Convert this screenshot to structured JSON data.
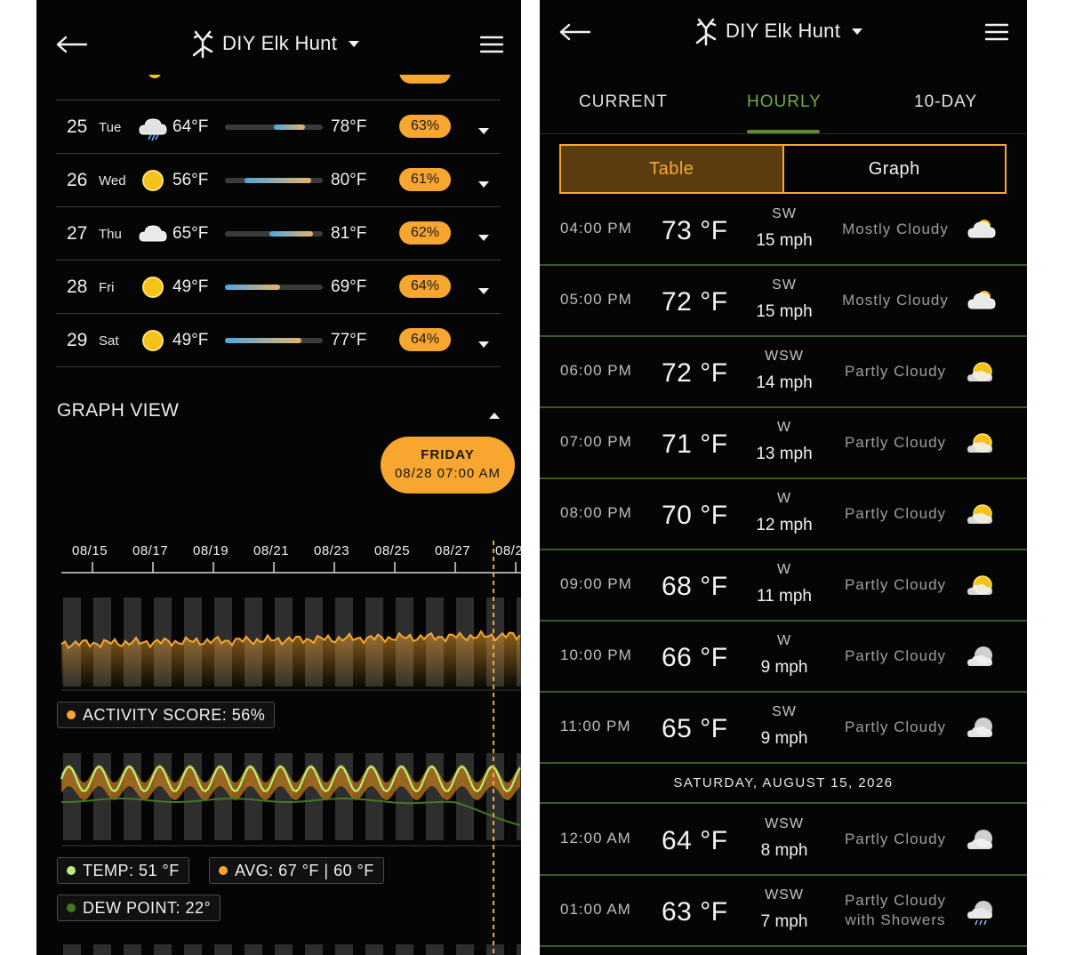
{
  "app": {
    "title": "DIY Elk Hunt"
  },
  "daily": [
    {
      "day": "25",
      "dow": "Tue",
      "icon": "thunder-cloud-icon",
      "low": "64°F",
      "high": "78°F",
      "score": "63%",
      "bar_start": 0.5,
      "bar_end": 0.82
    },
    {
      "day": "26",
      "dow": "Wed",
      "icon": "sun-icon",
      "low": "56°F",
      "high": "80°F",
      "score": "61%",
      "bar_start": 0.2,
      "bar_end": 0.88
    },
    {
      "day": "27",
      "dow": "Thu",
      "icon": "cloud-icon",
      "low": "65°F",
      "high": "81°F",
      "score": "62%",
      "bar_start": 0.45,
      "bar_end": 0.9
    },
    {
      "day": "28",
      "dow": "Fri",
      "icon": "sun-icon",
      "low": "49°F",
      "high": "69°F",
      "score": "64%",
      "bar_start": 0.0,
      "bar_end": 0.56
    },
    {
      "day": "29",
      "dow": "Sat",
      "icon": "sun-icon",
      "low": "49°F",
      "high": "77°F",
      "score": "64%",
      "bar_start": 0.0,
      "bar_end": 0.78
    }
  ],
  "graph": {
    "title": "GRAPH VIEW",
    "bubble_day": "FRIDAY",
    "bubble_time": "08/28 07:00 AM",
    "dates": [
      "08/15",
      "08/17",
      "08/19",
      "08/21",
      "08/23",
      "08/25",
      "08/27",
      "08/2"
    ],
    "activity_label": "ACTIVITY SCORE: 56%",
    "temp_label": "TEMP: 51 °F",
    "avg_label": "AVG: 67 °F | 60 °F",
    "dew_label": "DEW POINT: 22°",
    "colors": {
      "activity": "#f7a730",
      "temp": "#b6f07a",
      "dew": "#3f7a1e"
    }
  },
  "tabs": [
    {
      "label": "CURRENT",
      "active": false
    },
    {
      "label": "HOURLY",
      "active": true
    },
    {
      "label": "10-DAY",
      "active": false
    }
  ],
  "segment": {
    "table": "Table",
    "graph": "Graph"
  },
  "hourly": [
    {
      "time": "04:00 PM",
      "temp": "73 °F",
      "dir": "SW",
      "speed": "15 mph",
      "cond": "Mostly Cloudy",
      "icon": "mostly-cloudy-icon"
    },
    {
      "time": "05:00 PM",
      "temp": "72 °F",
      "dir": "SW",
      "speed": "15 mph",
      "cond": "Mostly Cloudy",
      "icon": "mostly-cloudy-icon"
    },
    {
      "time": "06:00 PM",
      "temp": "72 °F",
      "dir": "WSW",
      "speed": "14 mph",
      "cond": "Partly Cloudy",
      "icon": "partly-cloudy-icon"
    },
    {
      "time": "07:00 PM",
      "temp": "71 °F",
      "dir": "W",
      "speed": "13 mph",
      "cond": "Partly Cloudy",
      "icon": "partly-cloudy-icon"
    },
    {
      "time": "08:00 PM",
      "temp": "70 °F",
      "dir": "W",
      "speed": "12 mph",
      "cond": "Partly Cloudy",
      "icon": "partly-cloudy-icon"
    },
    {
      "time": "09:00 PM",
      "temp": "68 °F",
      "dir": "W",
      "speed": "11 mph",
      "cond": "Partly Cloudy",
      "icon": "partly-cloudy-icon"
    },
    {
      "time": "10:00 PM",
      "temp": "66 °F",
      "dir": "W",
      "speed": "9 mph",
      "cond": "Partly Cloudy",
      "icon": "partly-cloudy-night-icon"
    },
    {
      "time": "11:00 PM",
      "temp": "65 °F",
      "dir": "SW",
      "speed": "9 mph",
      "cond": "Partly Cloudy",
      "icon": "partly-cloudy-night-icon"
    }
  ],
  "day_separator": "SATURDAY, AUGUST 15, 2026",
  "hourly2": [
    {
      "time": "12:00 AM",
      "temp": "64 °F",
      "dir": "WSW",
      "speed": "8 mph",
      "cond": "Partly Cloudy",
      "icon": "partly-cloudy-night-icon"
    },
    {
      "time": "01:00 AM",
      "temp": "63 °F",
      "dir": "WSW",
      "speed": "7 mph",
      "cond1": "Partly Cloudy",
      "cond2": "with Showers",
      "icon": "night-showers-icon"
    }
  ]
}
